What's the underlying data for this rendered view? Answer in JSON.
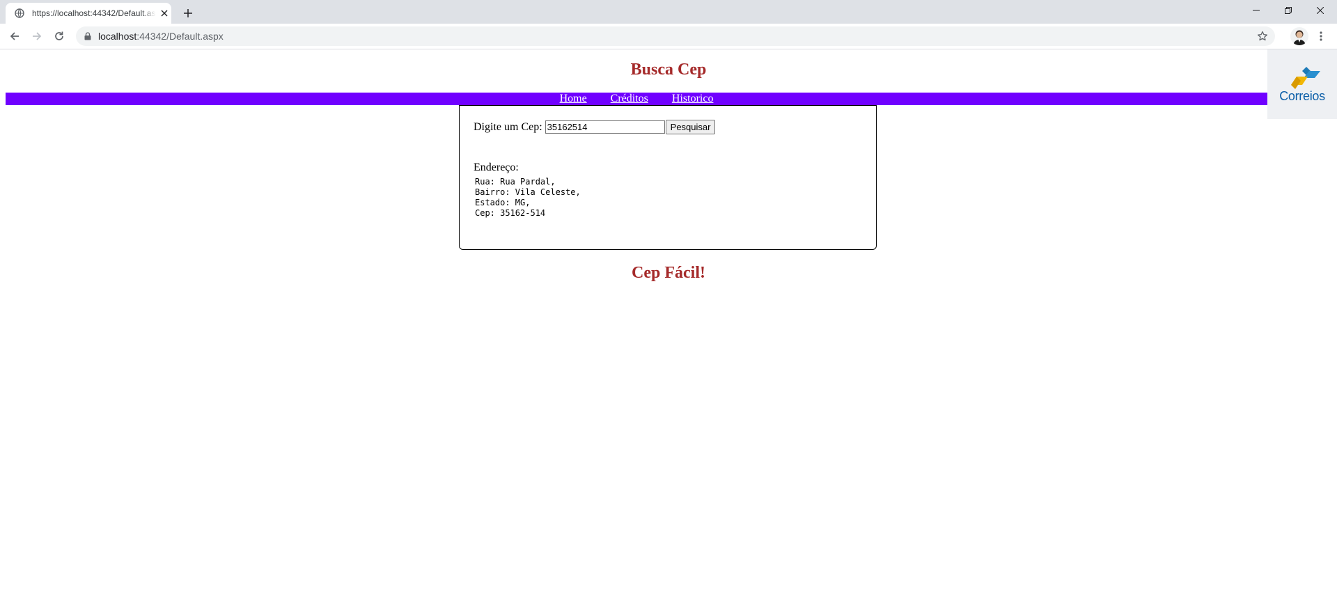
{
  "browser": {
    "tab_title": "https://localhost:44342/Default.aspx",
    "url_host": "localhost",
    "url_rest": ":44342/Default.aspx"
  },
  "page": {
    "title": "Busca Cep",
    "nav": [
      "Home",
      "Créditos",
      "Historico"
    ],
    "logo_text": "Correios",
    "search": {
      "label": "Digite um Cep:",
      "value": "35162514",
      "button": "Pesquisar"
    },
    "address": {
      "label": "Endereço:",
      "lines": [
        "Rua: Rua Pardal,",
        "Bairro: Vila Celeste,",
        "Estado: MG,",
        "Cep: 35162-514"
      ]
    },
    "footer": "Cep Fácil!"
  },
  "colors": {
    "title": "#a52a2a",
    "menu_bar": "#7000ff",
    "logo_blue": "#0b5ea8",
    "logo_yellow": "#f2b705"
  }
}
